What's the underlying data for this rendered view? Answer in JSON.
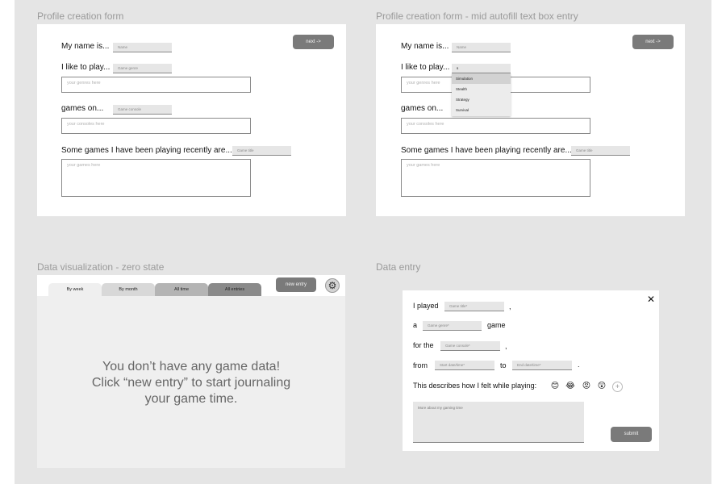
{
  "frames": {
    "profile": {
      "title": "Profile creation form",
      "next_label": "next ->",
      "name_label": "My name is...",
      "name_placeholder": "Name",
      "play_label": "I like to play...",
      "genre_placeholder": "Game genre",
      "genres_box": "your genres here",
      "console_label": "games on...",
      "console_placeholder": "Game console",
      "consoles_box": "your consoles here",
      "recent_label": "Some games I have been playing recently are...",
      "title_placeholder": "Game title",
      "games_box": "your games here"
    },
    "profile_autofill": {
      "title": "Profile creation form - mid autofill text box entry",
      "next_label": "next ->",
      "name_label": "My name is...",
      "name_placeholder": "Name",
      "play_label": "I like to play...",
      "typed_value": "s",
      "genres_box": "your genres here",
      "console_label": "games on...",
      "consoles_box": "your consoles here",
      "recent_label": "Some games I have been playing recently are...",
      "title_placeholder": "Game title",
      "games_box": "your games here",
      "dropdown": [
        "Simulation",
        "Stealth",
        "Strategy",
        "Survival"
      ]
    },
    "dataviz": {
      "title": "Data visualization - zero state",
      "tabs": [
        "By week",
        "By month",
        "All time",
        "All entries"
      ],
      "new_entry_label": "new entry",
      "gear_icon": "⚙",
      "empty_line1": "You don’t have any game data!",
      "empty_line2": "Click “new entry” to start journaling",
      "empty_line3": "your game time."
    },
    "data_entry": {
      "title": "Data entry",
      "close_icon": "✕",
      "played_label": "I played",
      "title_placeholder": "Game title*",
      "comma1": ",",
      "a_label": "a",
      "genre_placeholder": "Game genre*",
      "game_label": "game",
      "for_label": "for the",
      "console_placeholder": "Game console*",
      "comma2": ",",
      "from_label": "from",
      "start_placeholder": "Start date/time*",
      "to_label": "to",
      "end_placeholder": "End date/time*",
      "period": ".",
      "feel_label": "This describes how I felt while playing:",
      "emojis": [
        "😊",
        "😂",
        "😡",
        "😲"
      ],
      "add_icon": "+",
      "more_placeholder": "More about my gaming time",
      "submit_label": "submit"
    }
  }
}
